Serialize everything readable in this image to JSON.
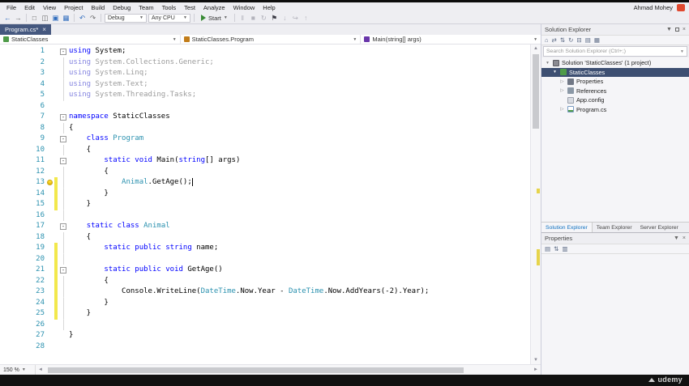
{
  "chrome": {
    "user_name": "Ahmad Mohey",
    "watermark": "udemy"
  },
  "menu": {
    "items": [
      "File",
      "Edit",
      "View",
      "Project",
      "Build",
      "Debug",
      "Team",
      "Tools",
      "Test",
      "Analyze",
      "Window",
      "Help"
    ]
  },
  "toolbar": {
    "debug_config": "Debug",
    "platform": "Any CPU",
    "start_label": "Start",
    "left_icons": [
      "back",
      "forward"
    ],
    "file_icons": [
      "new-project",
      "open-file",
      "save",
      "save-all"
    ],
    "edit_icons": [
      "undo",
      "redo"
    ],
    "debug_icons": [
      "pause",
      "stop",
      "restart",
      "flag",
      "step-into",
      "step-over",
      "step-out"
    ]
  },
  "editor": {
    "tab_label": "Program.cs*",
    "breadcrumb": {
      "project": "StaticClasses",
      "type": "StaticClasses.Program",
      "member": "Main(string[] args)"
    },
    "zoom": "150 %",
    "lines": [
      {
        "num": "1",
        "fold": true,
        "tokens": [
          [
            "using",
            "kw"
          ],
          [
            " System;",
            "pl"
          ]
        ]
      },
      {
        "num": "2",
        "guide": true,
        "tokens": [
          [
            "using",
            "kwf"
          ],
          [
            " System.Collections.Generic;",
            "gr"
          ]
        ]
      },
      {
        "num": "3",
        "guide": true,
        "tokens": [
          [
            "using",
            "kwf"
          ],
          [
            " System.Linq;",
            "gr"
          ]
        ]
      },
      {
        "num": "4",
        "guide": true,
        "tokens": [
          [
            "using",
            "kwf"
          ],
          [
            " System.Text;",
            "gr"
          ]
        ]
      },
      {
        "num": "5",
        "guide": true,
        "tokens": [
          [
            "using",
            "kwf"
          ],
          [
            " System.Threading.Tasks;",
            "gr"
          ]
        ]
      },
      {
        "num": "6",
        "tokens": []
      },
      {
        "num": "7",
        "fold": true,
        "tokens": [
          [
            "namespace",
            "kw"
          ],
          [
            " StaticClasses",
            "pl"
          ]
        ]
      },
      {
        "num": "8",
        "guide": true,
        "tokens": [
          [
            "{",
            "pl"
          ]
        ]
      },
      {
        "num": "9",
        "fold": true,
        "tokens": [
          [
            "    ",
            "pl"
          ],
          [
            "class",
            "kw"
          ],
          [
            " ",
            "pl"
          ],
          [
            "Program",
            "ty"
          ]
        ]
      },
      {
        "num": "10",
        "guide": true,
        "tokens": [
          [
            "    {",
            "pl"
          ]
        ]
      },
      {
        "num": "11",
        "fold": true,
        "tokens": [
          [
            "        ",
            "pl"
          ],
          [
            "static",
            "kw"
          ],
          [
            " ",
            "pl"
          ],
          [
            "void",
            "kw"
          ],
          [
            " Main(",
            "pl"
          ],
          [
            "string",
            "kw"
          ],
          [
            "[] args)",
            "pl"
          ]
        ]
      },
      {
        "num": "12",
        "guide": true,
        "tokens": [
          [
            "        {",
            "pl"
          ]
        ]
      },
      {
        "num": "13",
        "guide": true,
        "mod": true,
        "bulb": true,
        "caret": true,
        "tokens": [
          [
            "            ",
            "pl"
          ],
          [
            "Animal",
            "ty"
          ],
          [
            ".GetAge();",
            "pl"
          ]
        ]
      },
      {
        "num": "14",
        "guide": true,
        "mod": true,
        "tokens": [
          [
            "        }",
            "pl"
          ]
        ]
      },
      {
        "num": "15",
        "guide": true,
        "mod": true,
        "tokens": [
          [
            "    }",
            "pl"
          ]
        ]
      },
      {
        "num": "16",
        "guide": true,
        "tokens": []
      },
      {
        "num": "17",
        "fold": true,
        "tokens": [
          [
            "    ",
            "pl"
          ],
          [
            "static",
            "kw"
          ],
          [
            " ",
            "pl"
          ],
          [
            "class",
            "kw"
          ],
          [
            " ",
            "pl"
          ],
          [
            "Animal",
            "ty"
          ]
        ]
      },
      {
        "num": "18",
        "guide": true,
        "tokens": [
          [
            "    {",
            "pl"
          ]
        ]
      },
      {
        "num": "19",
        "guide": true,
        "mod": true,
        "tokens": [
          [
            "        ",
            "pl"
          ],
          [
            "static",
            "kw"
          ],
          [
            " ",
            "pl"
          ],
          [
            "public",
            "kw"
          ],
          [
            " ",
            "pl"
          ],
          [
            "string",
            "kw"
          ],
          [
            " name;",
            "pl"
          ]
        ]
      },
      {
        "num": "20",
        "guide": true,
        "mod": true,
        "tokens": []
      },
      {
        "num": "21",
        "fold": true,
        "mod": true,
        "tokens": [
          [
            "        ",
            "pl"
          ],
          [
            "static",
            "kw"
          ],
          [
            " ",
            "pl"
          ],
          [
            "public",
            "kw"
          ],
          [
            " ",
            "pl"
          ],
          [
            "void",
            "kw"
          ],
          [
            " GetAge()",
            "pl"
          ]
        ]
      },
      {
        "num": "22",
        "guide": true,
        "mod": true,
        "tokens": [
          [
            "        {",
            "pl"
          ]
        ]
      },
      {
        "num": "23",
        "guide": true,
        "mod": true,
        "tokens": [
          [
            "            Console.WriteLine(",
            "pl"
          ],
          [
            "DateTime",
            "ty"
          ],
          [
            ".Now.Year - ",
            "pl"
          ],
          [
            "DateTime",
            "ty"
          ],
          [
            ".Now.AddYears(-2).Year);",
            "pl"
          ]
        ]
      },
      {
        "num": "24",
        "guide": true,
        "mod": true,
        "tokens": [
          [
            "        }",
            "pl"
          ]
        ]
      },
      {
        "num": "25",
        "guide": true,
        "mod": true,
        "tokens": [
          [
            "    }",
            "pl"
          ]
        ]
      },
      {
        "num": "26",
        "guide": true,
        "tokens": []
      },
      {
        "num": "27",
        "tokens": [
          [
            "}",
            "pl"
          ]
        ]
      },
      {
        "num": "28",
        "tokens": []
      }
    ]
  },
  "solution_explorer": {
    "title": "Solution Explorer",
    "search_placeholder": "Search Solution Explorer (Ctrl+;)",
    "toolbar_icons": [
      "home",
      "switch-views",
      "sync-with-active-document",
      "refresh",
      "collapse-all",
      "show-all-files",
      "view-properties"
    ],
    "tree": [
      {
        "label": "Solution 'StaticClasses' (1 project)",
        "level": 0,
        "arrow": "expanded",
        "icon": "solution",
        "selected": false
      },
      {
        "label": "StaticClasses",
        "level": 1,
        "arrow": "expanded",
        "icon": "project",
        "selected": true
      },
      {
        "label": "Properties",
        "level": 2,
        "arrow": "collapsed",
        "icon": "properties",
        "selected": false
      },
      {
        "label": "References",
        "level": 2,
        "arrow": "collapsed",
        "icon": "references",
        "selected": false
      },
      {
        "label": "App.config",
        "level": 2,
        "arrow": "none",
        "icon": "config",
        "selected": false
      },
      {
        "label": "Program.cs",
        "level": 2,
        "arrow": "collapsed",
        "icon": "csfile",
        "selected": false
      }
    ],
    "bottom_tabs": [
      {
        "label": "Solution Explorer",
        "active": true
      },
      {
        "label": "Team Explorer",
        "active": false
      },
      {
        "label": "Server Explorer",
        "active": false
      }
    ]
  },
  "properties_panel": {
    "title": "Properties",
    "toolbar_icons": [
      "categorized",
      "alphabetical",
      "property-pages"
    ]
  }
}
